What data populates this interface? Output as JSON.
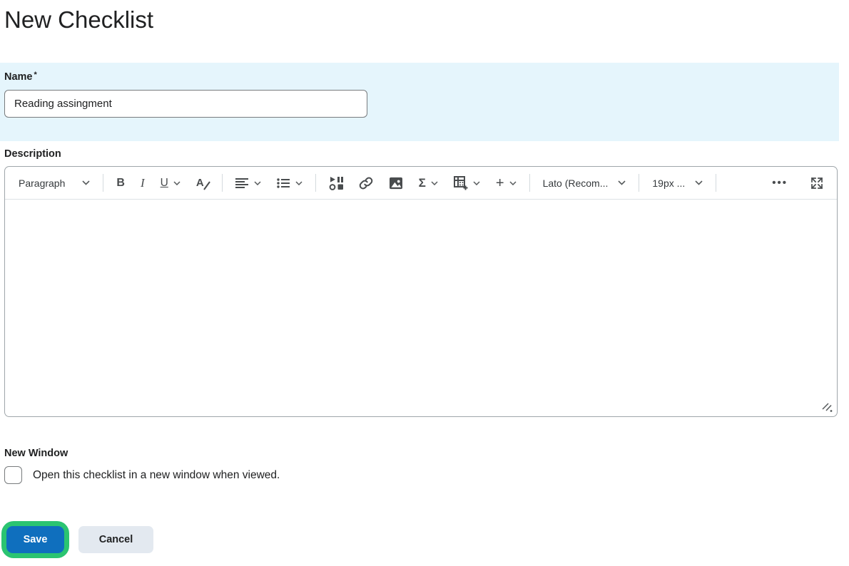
{
  "page": {
    "title": "New Checklist"
  },
  "name_section": {
    "label": "Name",
    "required_marker": "*",
    "input_value": "Reading assingment"
  },
  "description_section": {
    "label": "Description",
    "toolbar": {
      "paragraph_dropdown": "Paragraph",
      "bold": "B",
      "italic": "I",
      "underline": "U",
      "font_color": "A",
      "equation": "Σ",
      "insert_plus": "+",
      "font_family_dropdown": "Lato (Recom...",
      "font_size_dropdown": "19px ...",
      "more": "•••",
      "icon_names": [
        "chevron-down-icon",
        "align-icon",
        "unordered-list-icon",
        "insert-stuff-icon",
        "link-icon",
        "image-icon",
        "table-plus-icon",
        "fullscreen-icon",
        "resize-handle-icon"
      ]
    },
    "editor_content": ""
  },
  "new_window_section": {
    "label": "New Window",
    "checkbox_checked": false,
    "checkbox_label": "Open this checklist in a new window when viewed."
  },
  "actions": {
    "save": "Save",
    "cancel": "Cancel"
  },
  "colors": {
    "primary_blue": "#0f6fbe",
    "highlight_green": "#2bc471",
    "name_band_bg": "#e5f5fc",
    "icon": "#494c4e",
    "text": "#202122",
    "cancel_bg": "#e3e9f0"
  }
}
